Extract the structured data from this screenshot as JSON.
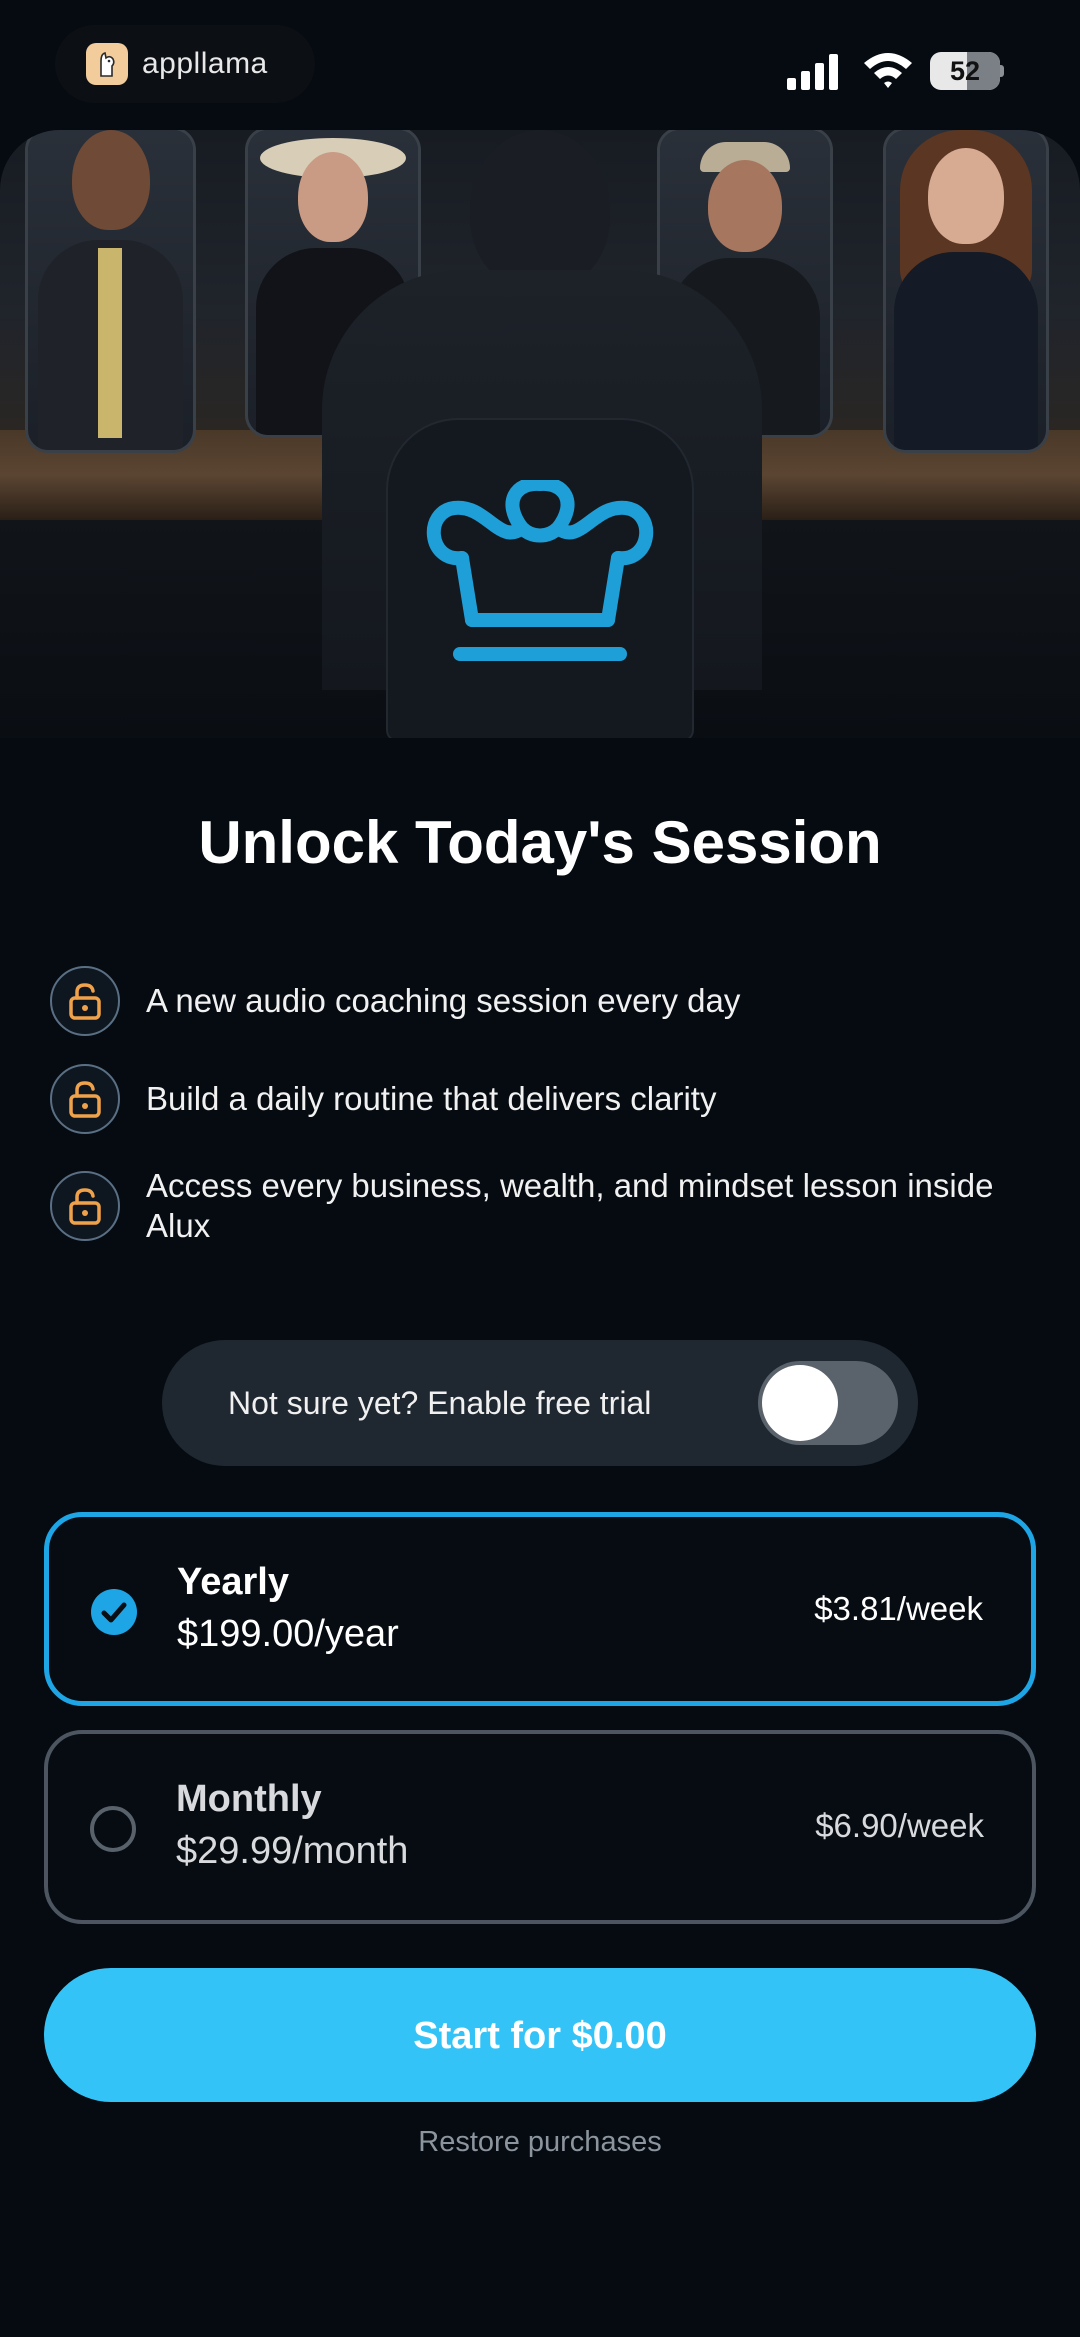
{
  "status_bar": {
    "brand_name": "appllama",
    "battery_level": "52"
  },
  "paywall": {
    "title": "Unlock Today's Session",
    "features": [
      "A new audio coaching session every day",
      "Build a daily routine that delivers clarity",
      "Access every business, wealth, and mindset lesson inside Alux"
    ],
    "trial_toggle": {
      "label": "Not sure yet? Enable free trial",
      "enabled": false
    },
    "plans": [
      {
        "name": "Yearly",
        "price": "$199.00/year",
        "weekly": "$3.81/week",
        "selected": true
      },
      {
        "name": "Monthly",
        "price": "$29.99/month",
        "weekly": "$6.90/week",
        "selected": false
      }
    ],
    "cta_label": "Start for $0.00",
    "restore_label": "Restore purchases"
  },
  "colors": {
    "accent": "#1ea5e6",
    "cta": "#34c3f7",
    "crown": "#1f9fd8",
    "lock": "#f0a24a",
    "background": "#050b11"
  },
  "icons": [
    "app-logo-icon",
    "signal-icon",
    "wifi-icon",
    "battery-icon",
    "crown-icon",
    "unlock-icon",
    "checkmark-icon"
  ]
}
